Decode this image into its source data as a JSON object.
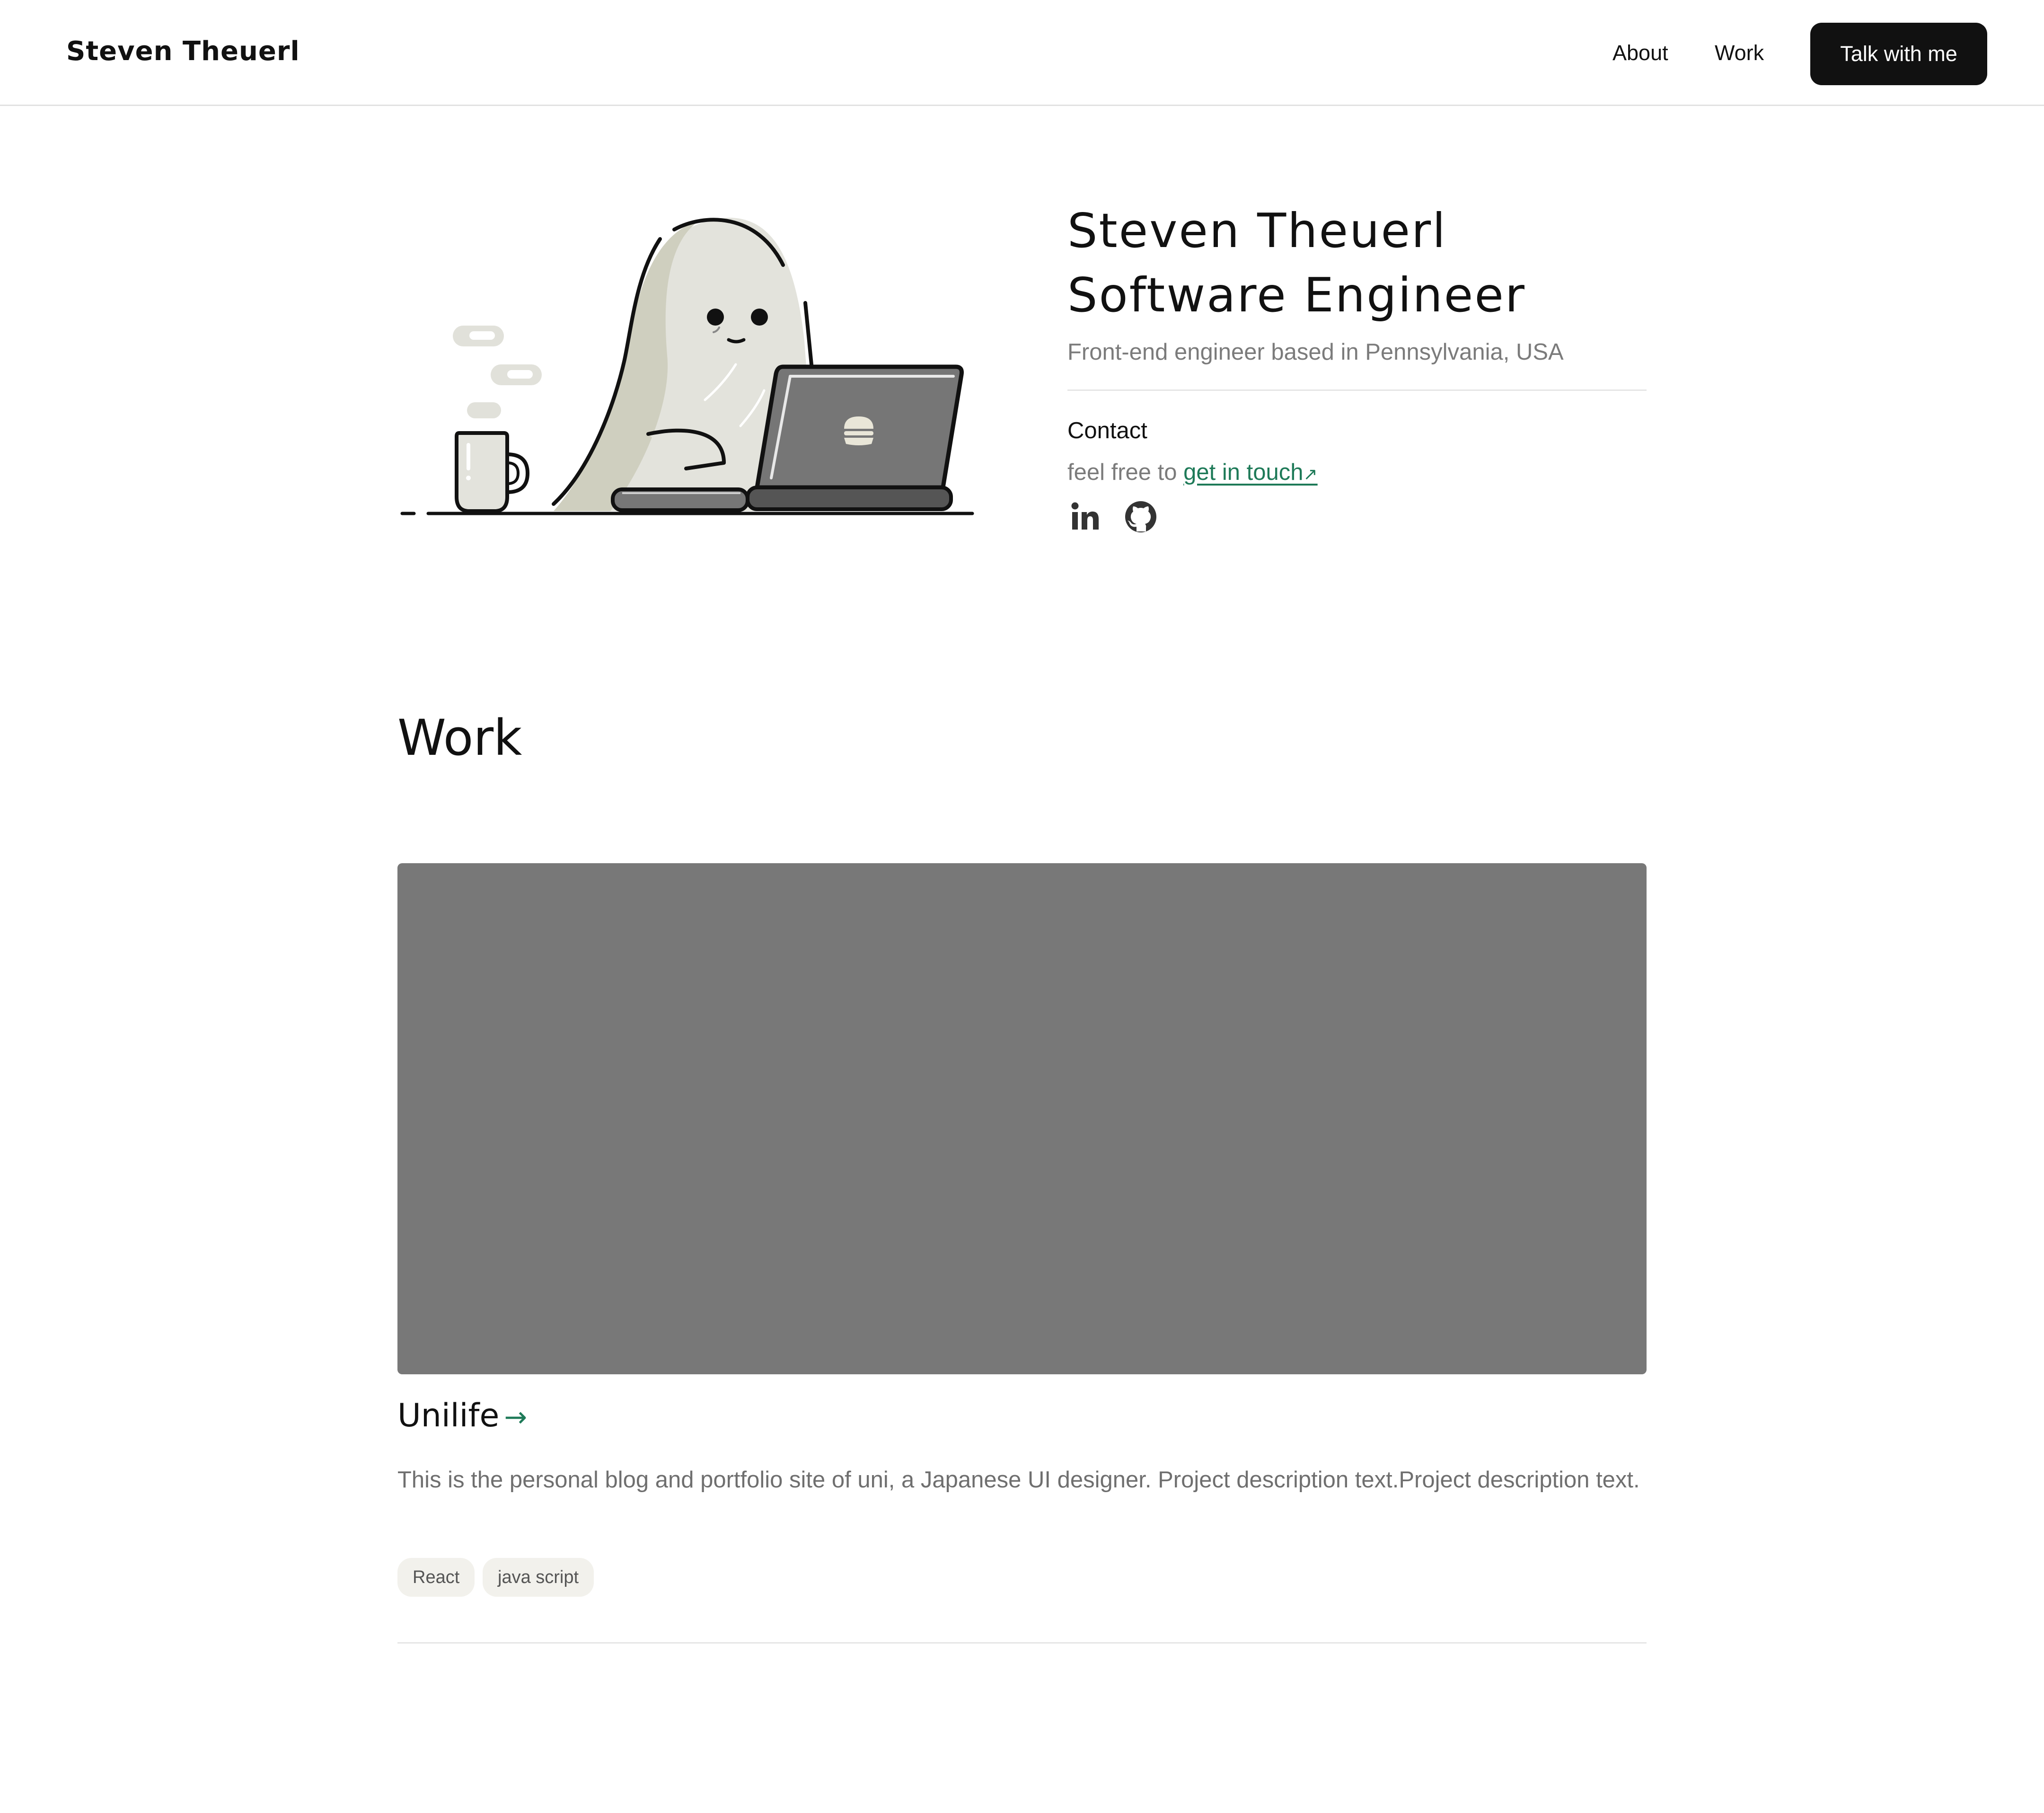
{
  "header": {
    "logo": "Steven Theuerl",
    "nav": [
      {
        "label": "About"
      },
      {
        "label": "Work"
      }
    ],
    "cta_label": "Talk with me"
  },
  "hero": {
    "title_line1": "Steven Theuerl",
    "title_line2": "Software Engineer",
    "subtitle": "Front-end engineer based in Pennsylvania, USA",
    "contact_label": "Contact",
    "contact_prefix": "feel free to ",
    "contact_link": "get in touch",
    "contact_link_icon": "↗",
    "social": [
      {
        "icon": "linkedin-icon"
      },
      {
        "icon": "github-icon"
      }
    ]
  },
  "work": {
    "title": "Work",
    "projects": [
      {
        "title": "Unilife",
        "arrow": "→",
        "description": "This is the personal blog and portfolio site of uni, a Japanese UI designer. Project description text.Project description text.",
        "tags": [
          "React",
          "java script"
        ]
      }
    ]
  },
  "colors": {
    "accent": "#1e7a58",
    "cta_background": "#111111",
    "image_placeholder": "#787878",
    "tag_background": "#f2f1ec"
  }
}
